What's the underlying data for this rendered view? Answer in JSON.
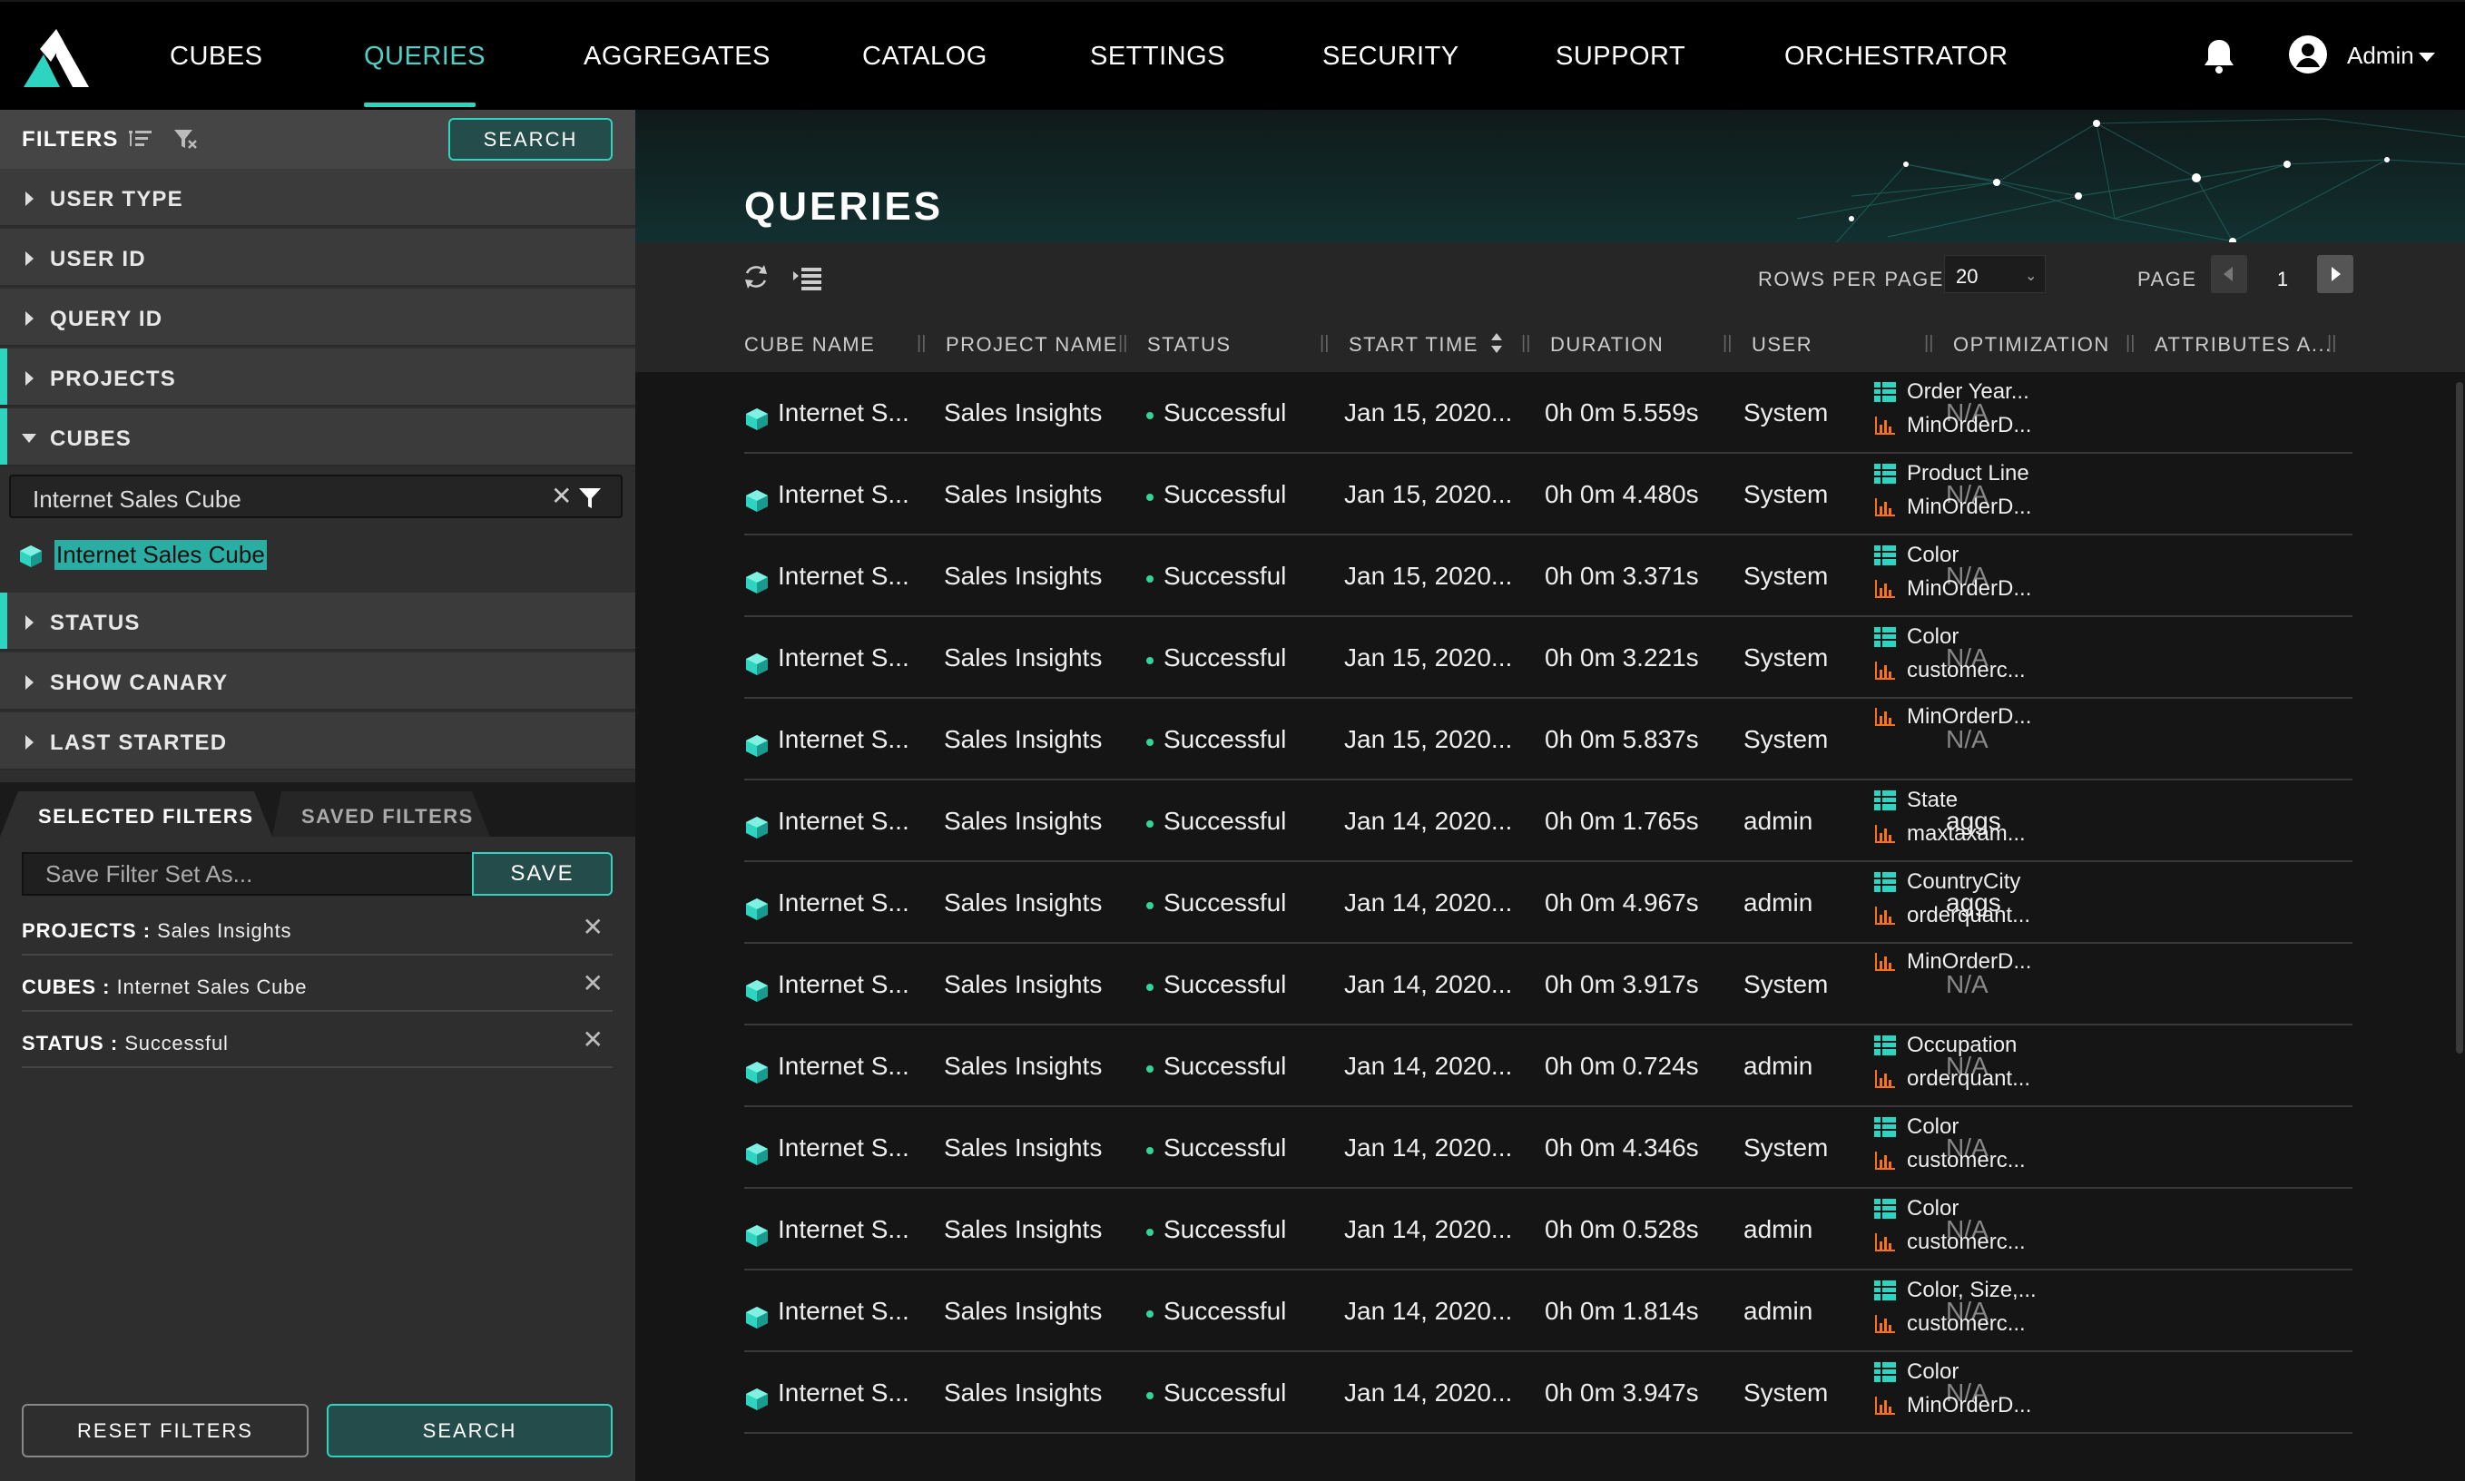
{
  "nav": {
    "items": [
      "CUBES",
      "QUERIES",
      "AGGREGATES",
      "CATALOG",
      "SETTINGS",
      "SECURITY",
      "SUPPORT",
      "ORCHESTRATOR"
    ],
    "active": "QUERIES",
    "user": "Admin"
  },
  "filters": {
    "title": "FILTERS",
    "search_label": "SEARCH",
    "sections": [
      "USER TYPE",
      "USER ID",
      "QUERY ID",
      "PROJECTS",
      "CUBES",
      "STATUS",
      "SHOW CANARY",
      "LAST STARTED"
    ],
    "cube_search_value": "Internet Sales Cube",
    "cube_option": "Internet Sales Cube",
    "tabs": [
      "SELECTED FILTERS",
      "SAVED FILTERS"
    ],
    "save_placeholder": "Save Filter Set As...",
    "save_label": "SAVE",
    "chips": [
      {
        "key": "PROJECTS :",
        "value": "Sales Insights"
      },
      {
        "key": "CUBES :",
        "value": "Internet Sales Cube"
      },
      {
        "key": "STATUS :",
        "value": "Successful"
      }
    ],
    "reset_label": "RESET FILTERS",
    "search_bottom_label": "SEARCH"
  },
  "main": {
    "title": "QUERIES",
    "rows_per_page_label": "ROWS PER PAGE",
    "rows_per_page": "20",
    "page_label": "PAGE",
    "page": "1",
    "columns": [
      "CUBE NAME",
      "PROJECT NAME",
      "STATUS",
      "START TIME",
      "DURATION",
      "USER",
      "OPTIMIZATION",
      "ATTRIBUTES A..."
    ],
    "rows": [
      {
        "cube": "Internet S...",
        "project": "Sales Insights",
        "status": "Successful",
        "start": "Jan 15, 2020...",
        "duration": "0h 0m 5.559s",
        "user": "System",
        "opt": "N/A",
        "attrs": [
          {
            "type": "dimension",
            "text": "Order Year..."
          },
          {
            "type": "measure",
            "text": "MinOrderD..."
          }
        ]
      },
      {
        "cube": "Internet S...",
        "project": "Sales Insights",
        "status": "Successful",
        "start": "Jan 15, 2020...",
        "duration": "0h 0m 4.480s",
        "user": "System",
        "opt": "N/A",
        "attrs": [
          {
            "type": "dimension",
            "text": "Product Line"
          },
          {
            "type": "measure",
            "text": "MinOrderD..."
          }
        ]
      },
      {
        "cube": "Internet S...",
        "project": "Sales Insights",
        "status": "Successful",
        "start": "Jan 15, 2020...",
        "duration": "0h 0m 3.371s",
        "user": "System",
        "opt": "N/A",
        "attrs": [
          {
            "type": "dimension",
            "text": "Color"
          },
          {
            "type": "measure",
            "text": "MinOrderD..."
          }
        ]
      },
      {
        "cube": "Internet S...",
        "project": "Sales Insights",
        "status": "Successful",
        "start": "Jan 15, 2020...",
        "duration": "0h 0m 3.221s",
        "user": "System",
        "opt": "N/A",
        "attrs": [
          {
            "type": "dimension",
            "text": "Color"
          },
          {
            "type": "measure",
            "text": "customerc..."
          }
        ]
      },
      {
        "cube": "Internet S...",
        "project": "Sales Insights",
        "status": "Successful",
        "start": "Jan 15, 2020...",
        "duration": "0h 0m 5.837s",
        "user": "System",
        "opt": "N/A",
        "attrs": [
          {
            "type": "measure",
            "text": "MinOrderD..."
          }
        ]
      },
      {
        "cube": "Internet S...",
        "project": "Sales Insights",
        "status": "Successful",
        "start": "Jan 14, 2020...",
        "duration": "0h 0m 1.765s",
        "user": "admin",
        "opt": "aggs",
        "attrs": [
          {
            "type": "dimension",
            "text": "State"
          },
          {
            "type": "measure",
            "text": "maxtaxam..."
          }
        ]
      },
      {
        "cube": "Internet S...",
        "project": "Sales Insights",
        "status": "Successful",
        "start": "Jan 14, 2020...",
        "duration": "0h 0m 4.967s",
        "user": "admin",
        "opt": "aggs",
        "attrs": [
          {
            "type": "dimension",
            "text": "CountryCity"
          },
          {
            "type": "measure",
            "text": "orderquant..."
          }
        ]
      },
      {
        "cube": "Internet S...",
        "project": "Sales Insights",
        "status": "Successful",
        "start": "Jan 14, 2020...",
        "duration": "0h 0m 3.917s",
        "user": "System",
        "opt": "N/A",
        "attrs": [
          {
            "type": "measure",
            "text": "MinOrderD..."
          }
        ]
      },
      {
        "cube": "Internet S...",
        "project": "Sales Insights",
        "status": "Successful",
        "start": "Jan 14, 2020...",
        "duration": "0h 0m 0.724s",
        "user": "admin",
        "opt": "N/A",
        "attrs": [
          {
            "type": "dimension",
            "text": "Occupation"
          },
          {
            "type": "measure",
            "text": "orderquant..."
          }
        ]
      },
      {
        "cube": "Internet S...",
        "project": "Sales Insights",
        "status": "Successful",
        "start": "Jan 14, 2020...",
        "duration": "0h 0m 4.346s",
        "user": "System",
        "opt": "N/A",
        "attrs": [
          {
            "type": "dimension",
            "text": "Color"
          },
          {
            "type": "measure",
            "text": "customerc..."
          }
        ]
      },
      {
        "cube": "Internet S...",
        "project": "Sales Insights",
        "status": "Successful",
        "start": "Jan 14, 2020...",
        "duration": "0h 0m 0.528s",
        "user": "admin",
        "opt": "N/A",
        "attrs": [
          {
            "type": "dimension",
            "text": "Color"
          },
          {
            "type": "measure",
            "text": "customerc..."
          }
        ]
      },
      {
        "cube": "Internet S...",
        "project": "Sales Insights",
        "status": "Successful",
        "start": "Jan 14, 2020...",
        "duration": "0h 0m 1.814s",
        "user": "admin",
        "opt": "N/A",
        "attrs": [
          {
            "type": "dimension",
            "text": "Color, Size,..."
          },
          {
            "type": "measure",
            "text": "customerc..."
          }
        ]
      },
      {
        "cube": "Internet S...",
        "project": "Sales Insights",
        "status": "Successful",
        "start": "Jan 14, 2020...",
        "duration": "0h 0m 3.947s",
        "user": "System",
        "opt": "N/A",
        "attrs": [
          {
            "type": "dimension",
            "text": "Color"
          },
          {
            "type": "measure",
            "text": "MinOrderD..."
          }
        ]
      }
    ]
  },
  "colors": {
    "accent": "#2dd4bf",
    "success": "#34d399",
    "measure": "#f97316"
  }
}
